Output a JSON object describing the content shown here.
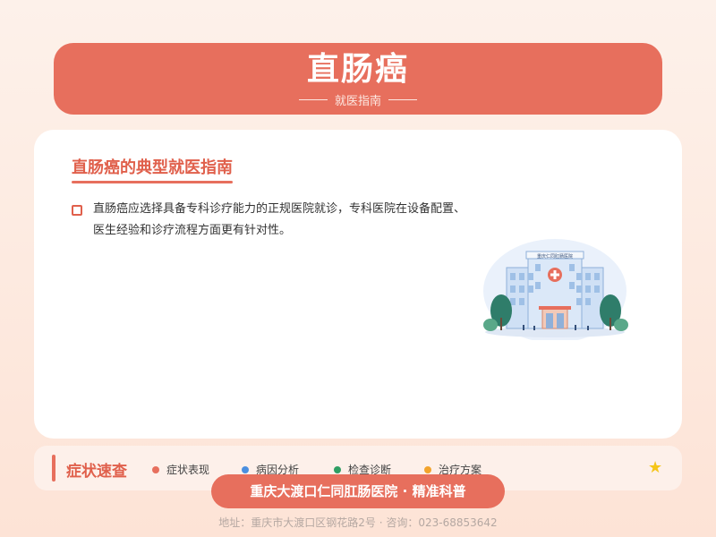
{
  "header": {
    "title": "直肠癌",
    "subtitle": "就医指南"
  },
  "card": {
    "heading": "直肠癌的典型就医指南",
    "items": [
      {
        "text": "直肠癌应选择具备专科诊疗能力的正规医院就诊，专科医院在设备配置、医生经验和诊疗流程方面更有针对性。"
      }
    ],
    "illustration": {
      "sign": "重庆仁同肛肠医院"
    }
  },
  "bottombar": {
    "label": "症状速查",
    "tags": [
      {
        "text": "症状表现",
        "color": "#e76f5d"
      },
      {
        "text": "病因分析",
        "color": "#4a8fe0"
      },
      {
        "text": "检查诊断",
        "color": "#2f9e63"
      },
      {
        "text": "治疗方案",
        "color": "#f2a32c"
      }
    ],
    "star_icon": "star-icon"
  },
  "pill": {
    "text": "重庆大渡口仁同肛肠医院 · 精准科普"
  },
  "footer": {
    "text": "地址：重庆市大渡口区钢花路2号 · 咨询：023-68853642"
  },
  "colors": {
    "accent": "#e76f5d",
    "heading": "#e0604c"
  }
}
